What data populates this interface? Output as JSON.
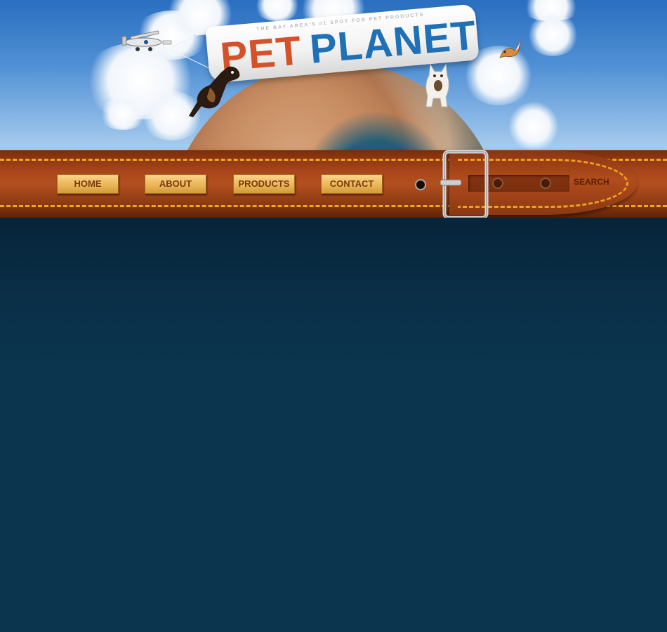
{
  "header": {
    "logo": {
      "tagline": "THE BAY AREA'S #1 SPOT FOR PET PRODUCTS",
      "word_one": "PET",
      "word_two": "PLANET"
    }
  },
  "nav": {
    "items": [
      {
        "label": "HOME"
      },
      {
        "label": "ABOUT"
      },
      {
        "label": "PRODUCTS"
      },
      {
        "label": "CONTACT"
      }
    ]
  },
  "search": {
    "label": "SEARCH",
    "value": ""
  },
  "colors": {
    "sky": "#4f8fd4",
    "belt": "#a8451a",
    "stitching": "#f4a41e",
    "button": "#eab757",
    "content_bg": "#0b354f",
    "logo_pet": "#d4522a",
    "logo_planet": "#1f70b5"
  }
}
